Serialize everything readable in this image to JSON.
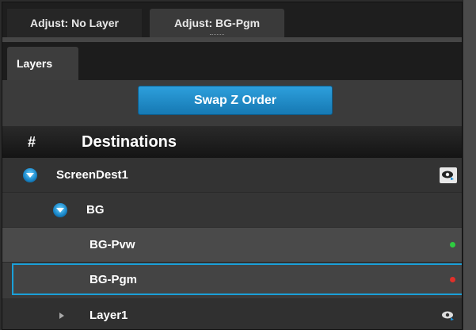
{
  "top_tabs": [
    {
      "label": "Adjust: No Layer"
    },
    {
      "label": "Adjust: BG-Pgm"
    }
  ],
  "sub_tabs": [
    {
      "label": "Layers"
    }
  ],
  "swap_button": {
    "label": "Swap Z Order"
  },
  "table_header": {
    "num": "#",
    "title": "Destinations"
  },
  "rows": [
    {
      "label": "ScreenDest1",
      "icon": "eye-icon"
    },
    {
      "label": "BG"
    },
    {
      "label": "BG-Pvw",
      "status_color": "#2ecc40"
    },
    {
      "label": "BG-Pgm",
      "status_color": "#e0302a"
    },
    {
      "label": "Layer1",
      "icon": "eye-icon"
    }
  ],
  "colors": {
    "accent": "#1aa0d8",
    "button": "#1b86c4"
  }
}
